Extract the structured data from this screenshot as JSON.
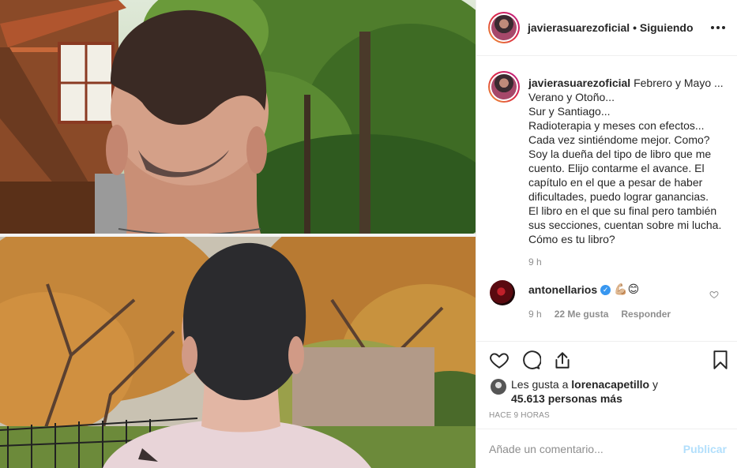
{
  "post": {
    "username": "javierasuarezoficial",
    "separator": "•",
    "follow_status": "Siguiendo",
    "caption_lines": [
      " Febrero y Mayo ...",
      "Verano y Otoño...",
      "Sur y Santiago...",
      "Radioterapia y meses con efectos...",
      "Cada vez sintiéndome mejor. Como?",
      "Soy la dueña del tipo de libro que me",
      "cuento. Elijo contarme el avance. El",
      "capítulo en el que a pesar de haber",
      "dificultades, puedo lograr ganancias.",
      "El libro en el que su final pero también",
      "sus secciones, cuentan sobre mi lucha.",
      "Cómo es tu libro?"
    ],
    "caption_time": "9 h"
  },
  "comment": {
    "username": "antonellarios",
    "verified_mark": "✓",
    "text": "💪🏼😊",
    "time": "9 h",
    "likes": "22 Me gusta",
    "reply": "Responder"
  },
  "likes": {
    "prefix": "Les gusta a ",
    "user": "lorenacapetillo",
    "middle": " y",
    "others": "45.613 personas más"
  },
  "posted_ago": "HACE 9 HORAS",
  "add_comment": {
    "placeholder": "Añade un comentario...",
    "publish_label": "Publicar"
  },
  "colors": {
    "accent_disabled": "#b2dffc",
    "secondary_text": "#8e8e8e",
    "verified": "#3897f0"
  },
  "icons": {
    "more": "more-options-icon",
    "like": "heart-icon",
    "comment": "comment-bubble-icon",
    "share": "share-icon",
    "save": "bookmark-icon"
  }
}
